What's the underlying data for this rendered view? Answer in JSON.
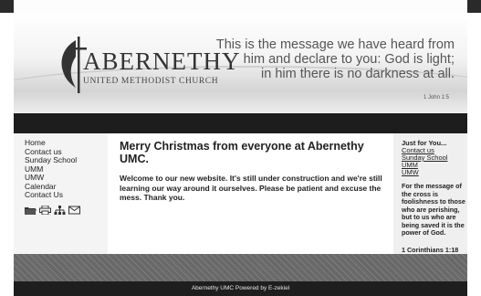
{
  "header": {
    "logo_name": "ABERNETHY",
    "logo_subtitle": "UNITED METHODIST CHURCH",
    "verse_lines": [
      "This is the message we have heard from",
      "him and declare to you: God is light;",
      "in him there is no darkness at all."
    ],
    "verse_ref": "1 John 1:5"
  },
  "sidebar": {
    "links": [
      "Home",
      "Contact us",
      "Sunday School",
      "UMM",
      "UMW",
      "Calendar",
      "Contact Us"
    ],
    "icons": [
      "folder-icon",
      "printer-icon",
      "sitemap-icon",
      "mail-icon"
    ]
  },
  "main": {
    "title": "Merry Christmas from everyone at Abernethy UMC.",
    "body": "Welcome to our new website. It's still under construction and we're still learning our way around it ourselves. Please be patient and excuse the mess. Thank you."
  },
  "right": {
    "heading": "Just for You...",
    "links": [
      "Contact us",
      "Sunday School",
      "UMM",
      "UMW"
    ],
    "message": "For the message of the cross is foolishness to those who are perishing, but to us who are being saved it is the power of God.",
    "reference": "1 Corinthians 1:18"
  },
  "footer": {
    "text": "Abernethy UMC Powered by E-zekiel"
  }
}
